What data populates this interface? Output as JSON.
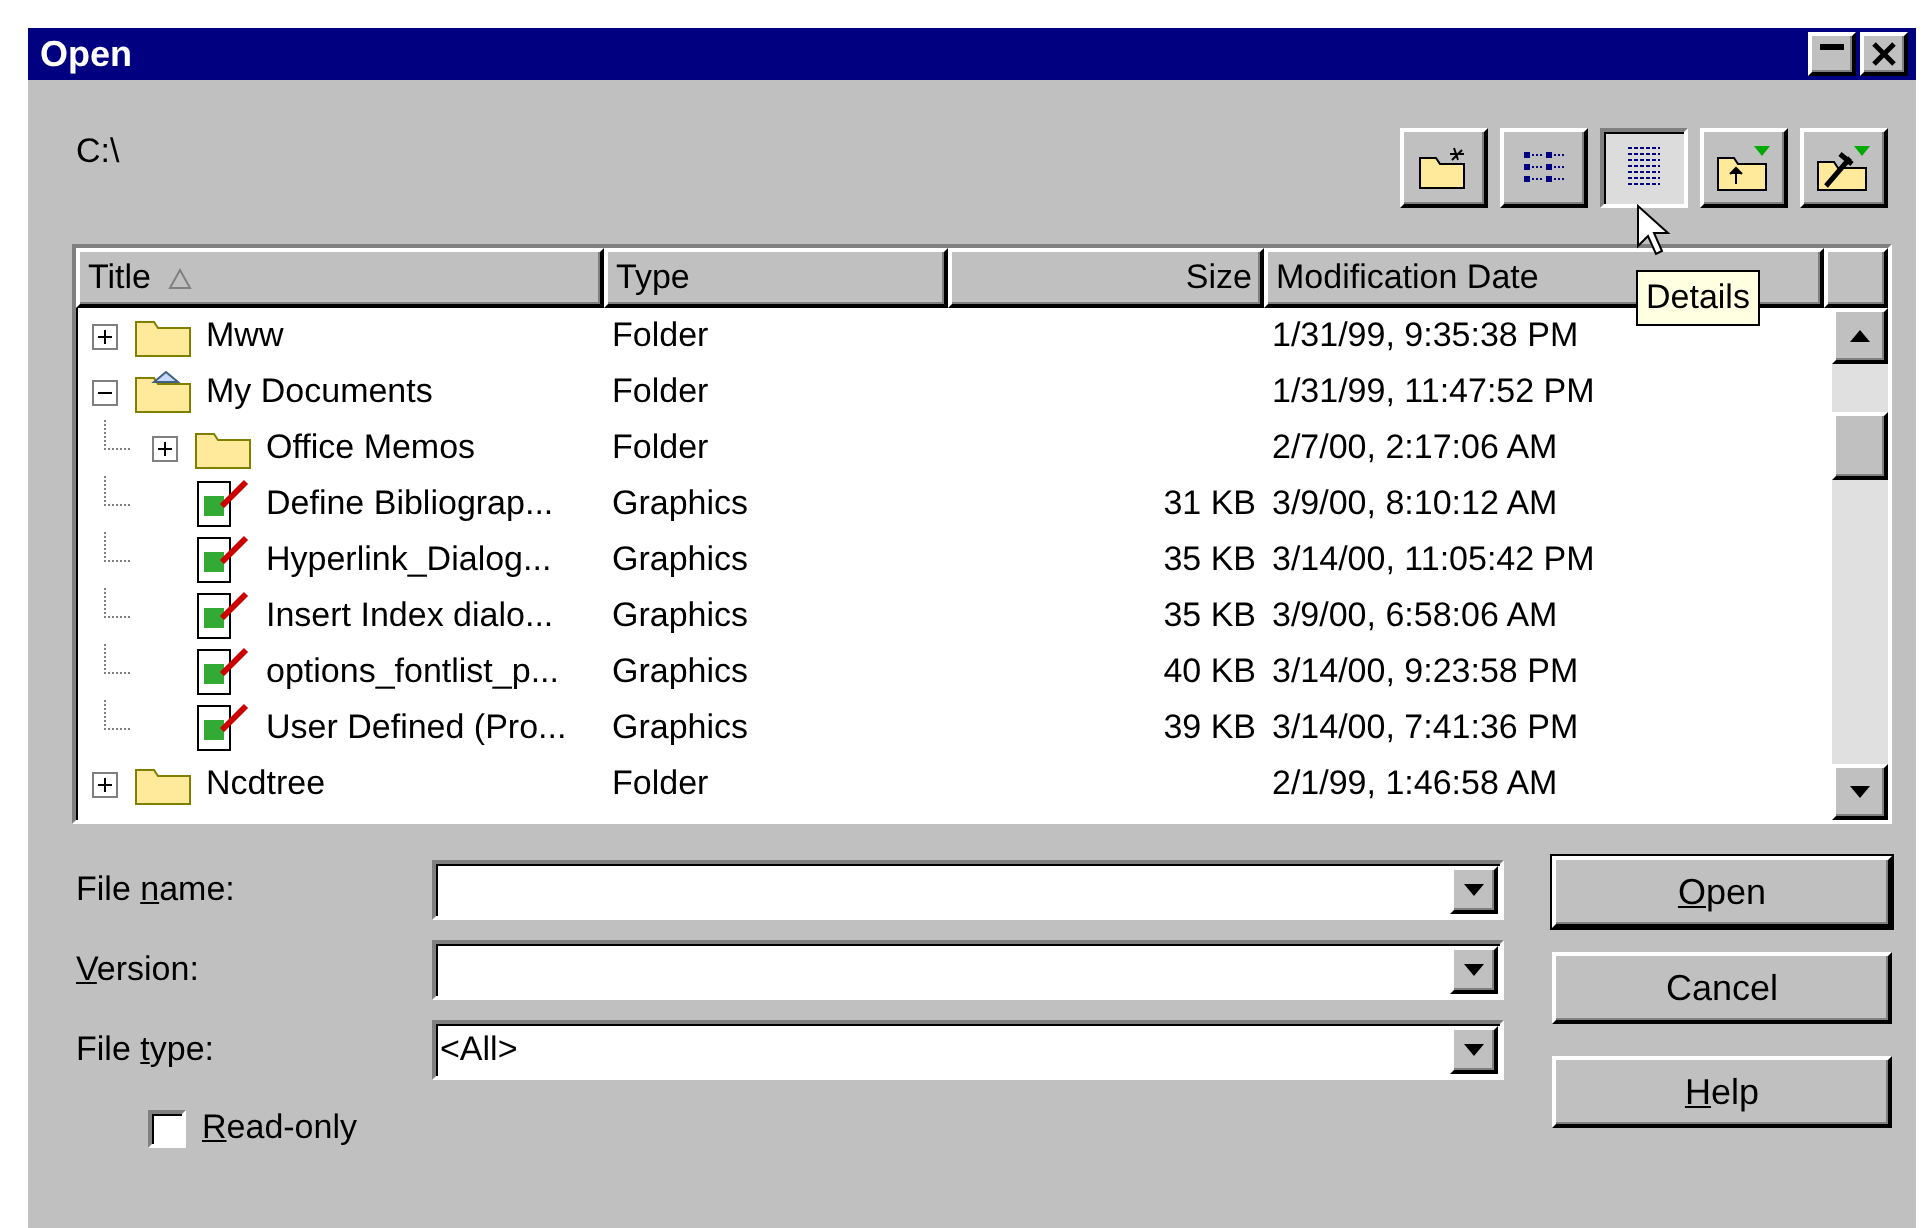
{
  "window": {
    "title": "Open"
  },
  "title_buttons": [
    {
      "kind": "maximize"
    },
    {
      "kind": "close"
    }
  ],
  "path": "C:\\",
  "toolbar": [
    {
      "kind": "new-folder",
      "selected": false
    },
    {
      "kind": "list",
      "selected": false
    },
    {
      "kind": "details",
      "selected": true
    },
    {
      "kind": "up-folder",
      "selected": false
    },
    {
      "kind": "tools",
      "selected": false
    }
  ],
  "tooltip": "Details",
  "columns": [
    {
      "label": "Title",
      "sorted": true
    },
    {
      "label": "Type",
      "sorted": false
    },
    {
      "label": "Size",
      "sorted": false
    },
    {
      "label": "Modification Date",
      "sorted": false
    }
  ],
  "rows": [
    {
      "kind": "folder",
      "name": "Mww",
      "type": "Folder",
      "date": "1/31/99, 9:35:38 PM",
      "expanded": false
    },
    {
      "kind": "home-folder",
      "name": "My Documents",
      "type": "Folder",
      "date": "1/31/99, 11:47:52 PM",
      "expanded": true,
      "children": [
        {
          "kind": "folder",
          "name": "Office Memos",
          "type": "Folder",
          "date": "2/7/00, 2:17:06 AM",
          "expanded": false
        },
        {
          "kind": "graphic",
          "name": "Define Bibliograp...",
          "type": "Graphics",
          "size": "31 KB",
          "date": "3/9/00, 8:10:12 AM"
        },
        {
          "kind": "graphic",
          "name": "Hyperlink_Dialog...",
          "type": "Graphics",
          "size": "35 KB",
          "date": "3/14/00, 11:05:42 PM"
        },
        {
          "kind": "graphic",
          "name": "Insert Index dialo...",
          "type": "Graphics",
          "size": "35 KB",
          "date": "3/9/00, 6:58:06 AM"
        },
        {
          "kind": "graphic",
          "name": "options_fontlist_p...",
          "type": "Graphics",
          "size": "40 KB",
          "date": "3/14/00, 9:23:58 PM"
        },
        {
          "kind": "graphic",
          "name": "User Defined (Pro...",
          "type": "Graphics",
          "size": "39 KB",
          "date": "3/14/00, 7:41:36 PM"
        }
      ]
    },
    {
      "kind": "folder",
      "name": "Ncdtree",
      "type": "Folder",
      "date": "2/1/99, 1:46:58 AM",
      "expanded": false
    }
  ],
  "fields": [
    {
      "label": [
        {
          "t": "File ",
          "u": false
        },
        {
          "t": "n",
          "u": true
        },
        {
          "t": "ame:",
          "u": false
        }
      ]
    },
    {
      "label": [
        {
          "t": "V",
          "u": true
        },
        {
          "t": "ersion:",
          "u": false
        }
      ]
    },
    {
      "label": [
        {
          "t": "File ",
          "u": false
        },
        {
          "t": "t",
          "u": true
        },
        {
          "t": "ype:",
          "u": false
        }
      ],
      "value": "<All>"
    }
  ],
  "buttons": [
    {
      "label": [
        {
          "t": "O",
          "u": true
        },
        {
          "t": "pen",
          "u": false
        }
      ],
      "default": true
    },
    {
      "label": [
        {
          "t": "Cancel",
          "u": false
        }
      ],
      "default": false
    },
    {
      "label": [
        {
          "t": "H",
          "u": true
        },
        {
          "t": "elp",
          "u": false
        }
      ],
      "default": false
    }
  ],
  "read_only": {
    "label": [
      {
        "t": "R",
        "u": true
      },
      {
        "t": "ead-only",
        "u": false
      }
    ],
    "checked": false
  }
}
